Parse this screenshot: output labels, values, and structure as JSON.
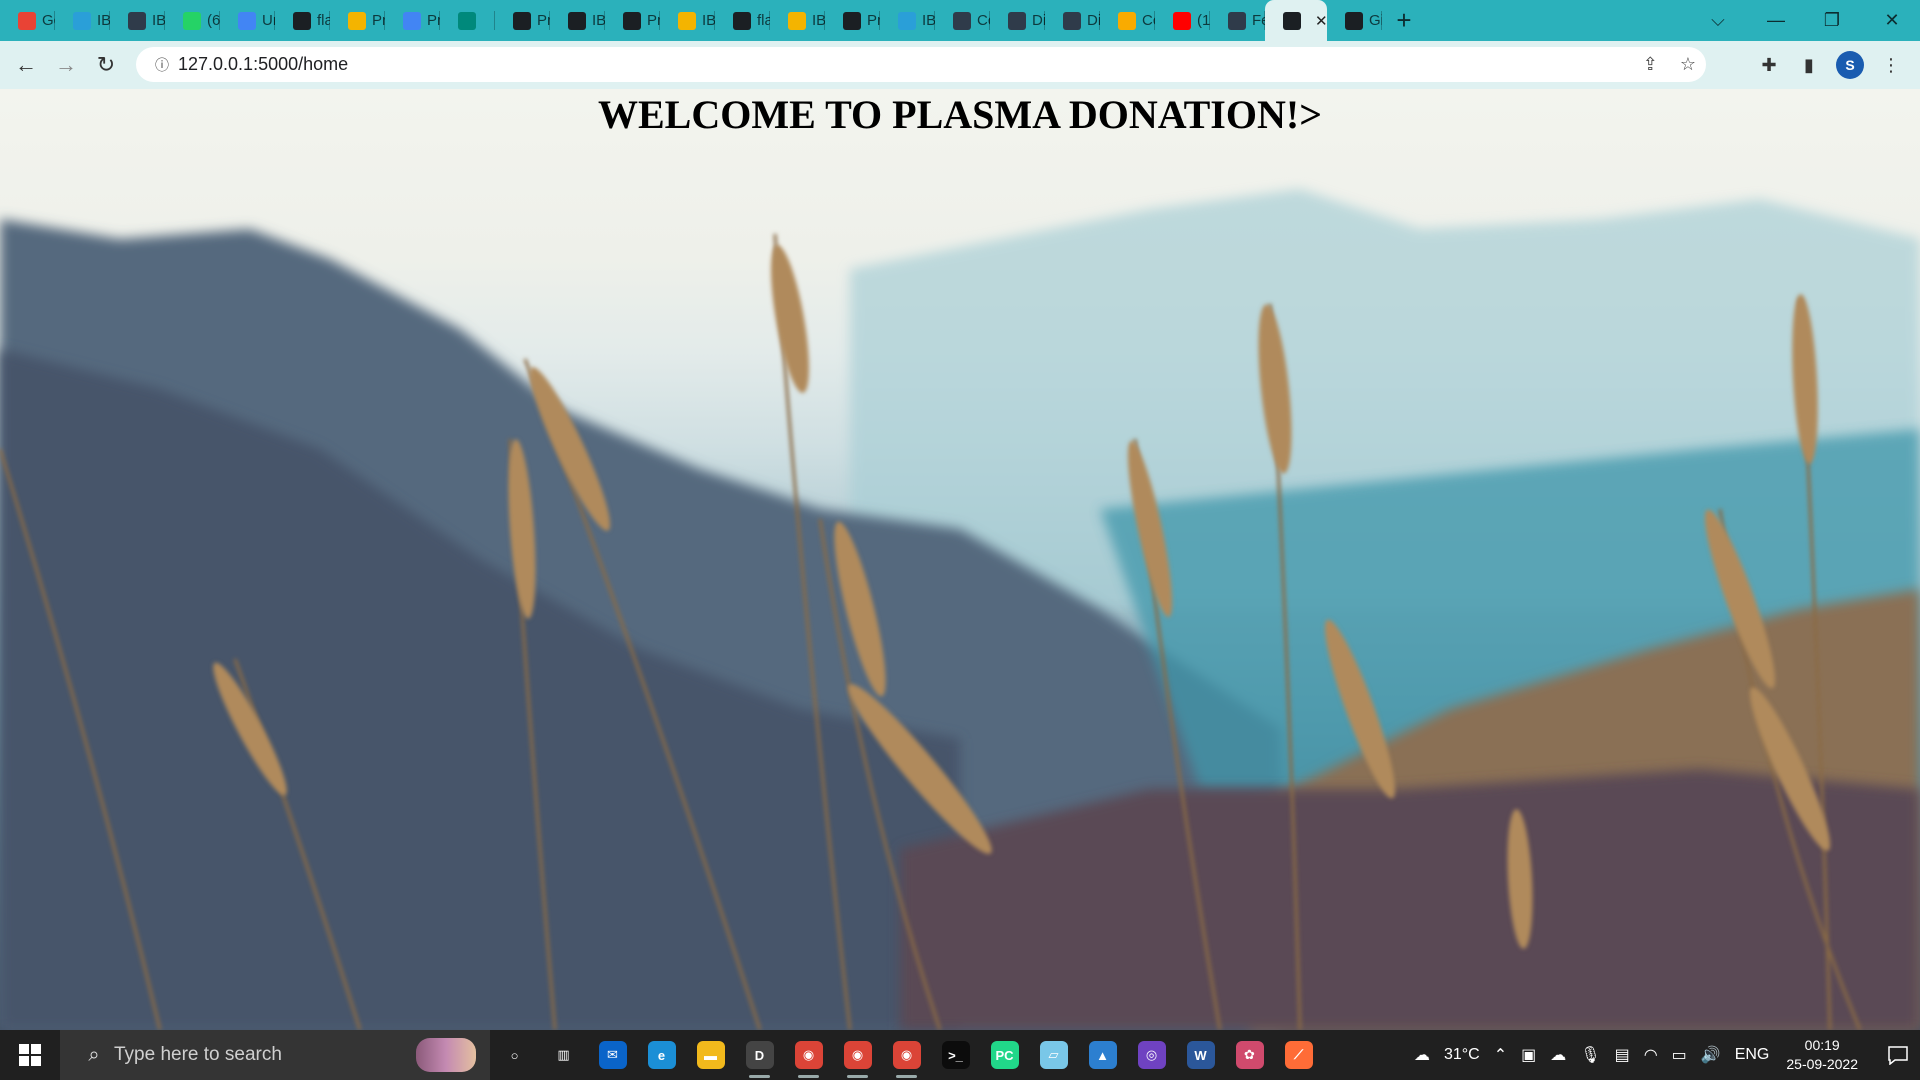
{
  "browser": {
    "tabs": [
      {
        "label": "Gc",
        "icon": "gmail-icon",
        "color": "#e94335"
      },
      {
        "label": "IB",
        "icon": "ibm-cloud-icon",
        "color": "#2a9fd8"
      },
      {
        "label": "IB",
        "icon": "ibm-node-icon",
        "color": "#2f3b4a"
      },
      {
        "label": "(6",
        "icon": "whatsapp-icon",
        "color": "#25d366"
      },
      {
        "label": "Ur",
        "icon": "docs-icon",
        "color": "#4285f4"
      },
      {
        "label": "fla",
        "icon": "github-icon",
        "color": "#1b1f23"
      },
      {
        "label": "Pr",
        "icon": "drive-icon",
        "color": "#f4b400"
      },
      {
        "label": "Pr",
        "icon": "docs-icon",
        "color": "#4285f4"
      },
      {
        "label": "",
        "icon": "meet-record-icon",
        "color": "#00897b"
      },
      {
        "label": "Pr",
        "icon": "globe-icon",
        "color": "#1b1f23"
      },
      {
        "label": "IB",
        "icon": "github-icon",
        "color": "#1b1f23"
      },
      {
        "label": "Pr",
        "icon": "globe-icon",
        "color": "#1b1f23"
      },
      {
        "label": "IB",
        "icon": "slides-icon",
        "color": "#f4b400"
      },
      {
        "label": "fla",
        "icon": "github-icon",
        "color": "#1b1f23"
      },
      {
        "label": "IB",
        "icon": "slides-icon",
        "color": "#f4b400"
      },
      {
        "label": "Pr",
        "icon": "globe-icon",
        "color": "#1b1f23"
      },
      {
        "label": "IB",
        "icon": "ibm-cloud-icon",
        "color": "#2a9fd8"
      },
      {
        "label": "Cc",
        "icon": "ibm-node-icon",
        "color": "#2f3b4a"
      },
      {
        "label": "Di",
        "icon": "ibm-node-icon",
        "color": "#2f3b4a"
      },
      {
        "label": "Di",
        "icon": "ibm-node-icon",
        "color": "#2f3b4a"
      },
      {
        "label": "Cc",
        "icon": "colab-icon",
        "color": "#f9ab00"
      },
      {
        "label": "(1",
        "icon": "youtube-icon",
        "color": "#ff0000"
      },
      {
        "label": "Fe",
        "icon": "ibm-node-icon",
        "color": "#2f3b4a"
      },
      {
        "label": "",
        "icon": "globe-icon",
        "color": "#1b1f23",
        "active": true
      },
      {
        "label": "Gi",
        "icon": "globe-icon",
        "color": "#1b1f23"
      }
    ],
    "new_tab_label": "+",
    "url": "127.0.0.1:5000/home",
    "profile_initial": "S"
  },
  "page": {
    "title": "WELCOME TO PLASMA DONATION!>"
  },
  "taskbar": {
    "search_placeholder": "Type here to search",
    "apps": [
      {
        "name": "cortana-icon",
        "color": "#202020",
        "glyph": "○"
      },
      {
        "name": "task-view-icon",
        "color": "#202020",
        "glyph": "▥"
      },
      {
        "name": "mail-icon",
        "color": "#0a64c9",
        "glyph": "✉"
      },
      {
        "name": "edge-icon",
        "color": "#1b8fd6",
        "glyph": "e"
      },
      {
        "name": "file-explorer-icon",
        "color": "#f2b91c",
        "glyph": "▬"
      },
      {
        "name": "dell-icon",
        "color": "#444444",
        "glyph": "D"
      },
      {
        "name": "chrome-icon",
        "color": "#db4437",
        "glyph": "◉"
      },
      {
        "name": "chrome-profile-icon",
        "color": "#db4437",
        "glyph": "◉"
      },
      {
        "name": "chrome-app-icon",
        "color": "#db4437",
        "glyph": "◉"
      },
      {
        "name": "terminal-icon",
        "color": "#0c0c0c",
        "glyph": ">_"
      },
      {
        "name": "pycharm-icon",
        "color": "#21d789",
        "glyph": "PC"
      },
      {
        "name": "notepad-icon",
        "color": "#79c7e8",
        "glyph": "▱"
      },
      {
        "name": "photos-icon",
        "color": "#2c7fd0",
        "glyph": "▲"
      },
      {
        "name": "github-desktop-icon",
        "color": "#6f42c1",
        "glyph": "◎"
      },
      {
        "name": "word-icon",
        "color": "#2b579a",
        "glyph": "W"
      },
      {
        "name": "paint-icon",
        "color": "#d04a6d",
        "glyph": "✿"
      },
      {
        "name": "postman-icon",
        "color": "#ff6c37",
        "glyph": "⟋"
      }
    ],
    "weather": "31°C",
    "language": "ENG",
    "time": "00:19",
    "date": "25-09-2022"
  }
}
